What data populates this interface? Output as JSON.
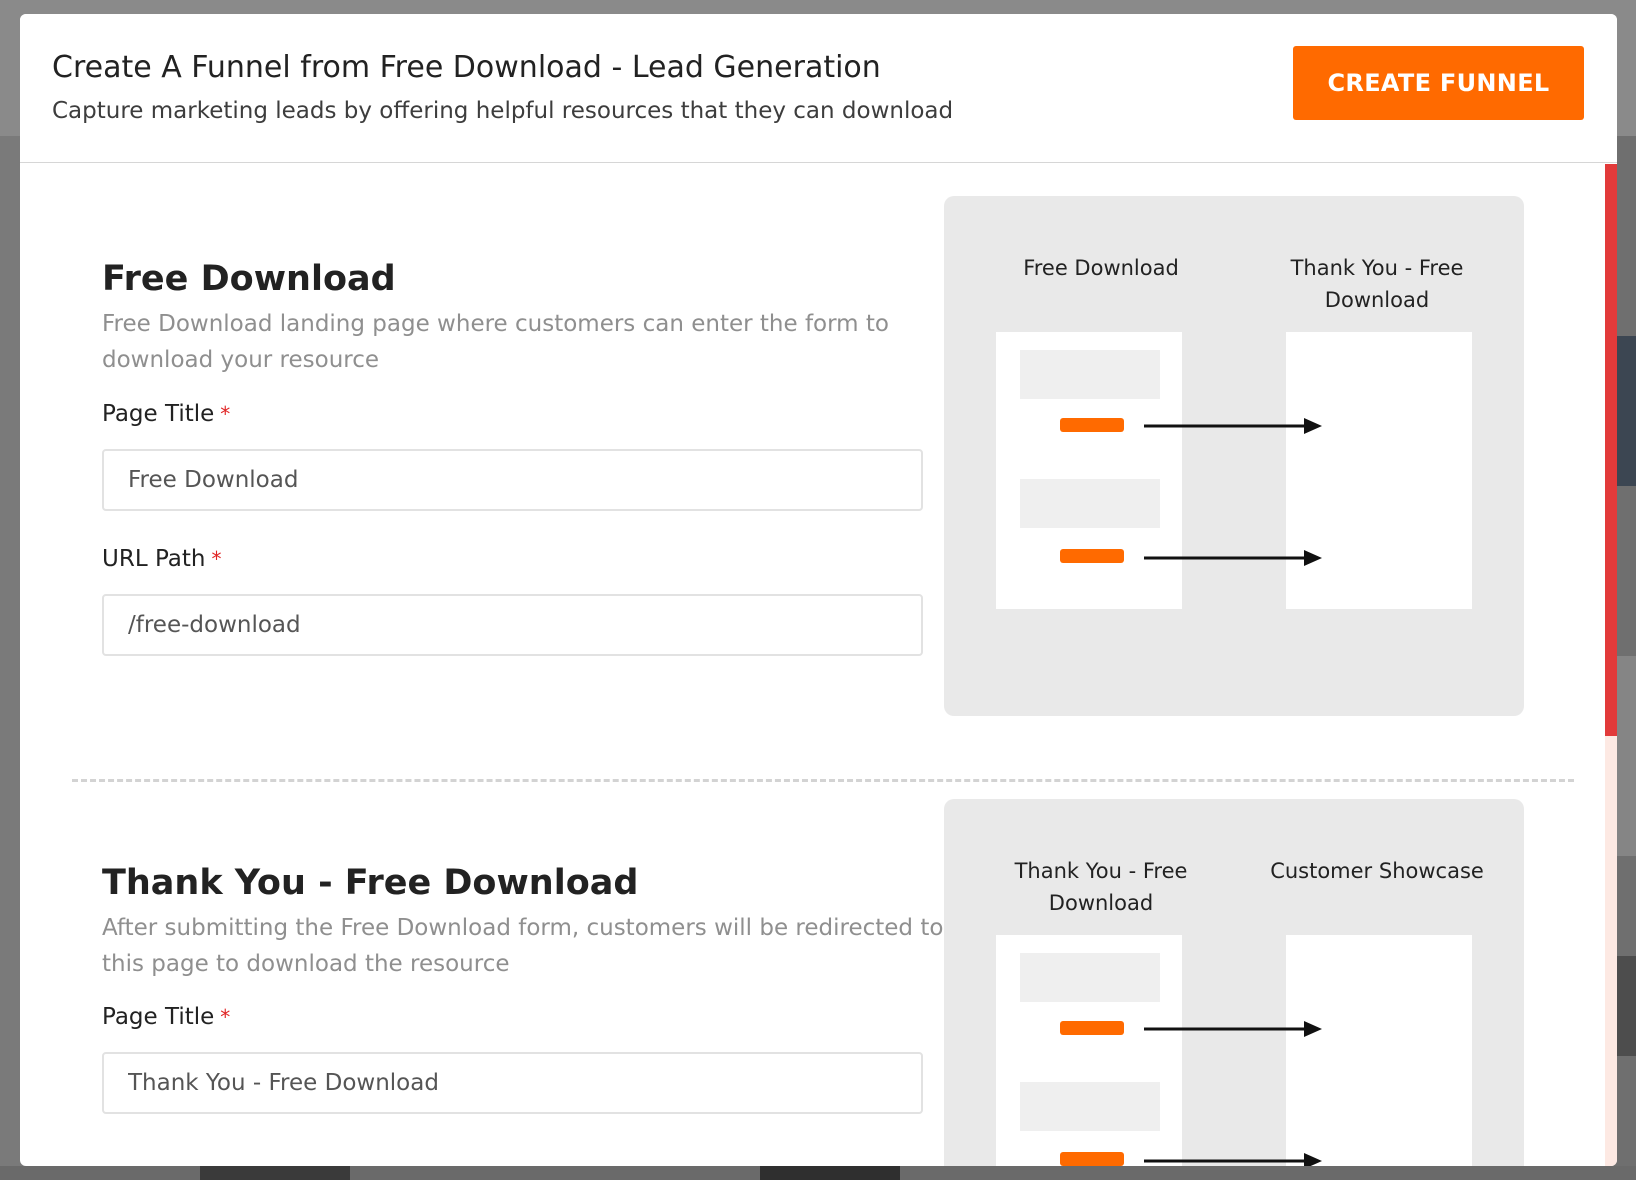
{
  "modal": {
    "title": "Create A Funnel from Free Download - Lead Generation",
    "subtitle": "Capture marketing leads by offering helpful resources that they can download",
    "create_button_label": "CREATE FUNNEL"
  },
  "sections": [
    {
      "heading": "Free Download",
      "description": "Free Download landing page where customers can enter the form to download your resource",
      "page_title_label": "Page Title",
      "page_title_value": "Free Download",
      "url_path_label": "URL Path",
      "url_path_value": "/free-download",
      "required_mark": "*",
      "preview": {
        "from_label": "Free Download",
        "to_label": "Thank You - Free Download"
      }
    },
    {
      "heading": "Thank You - Free Download",
      "description": "After submitting the Free Download form, customers will be redirected to this page to download the resource",
      "page_title_label": "Page Title",
      "page_title_value": "Thank You - Free Download",
      "required_mark": "*",
      "preview": {
        "from_label": "Thank You - Free Download",
        "to_label": "Customer Showcase"
      }
    }
  ],
  "colors": {
    "accent": "#ff6a00",
    "required": "#e02424",
    "preview_bg": "#e9e9e9"
  },
  "icons": [
    "arrow-right-icon"
  ]
}
